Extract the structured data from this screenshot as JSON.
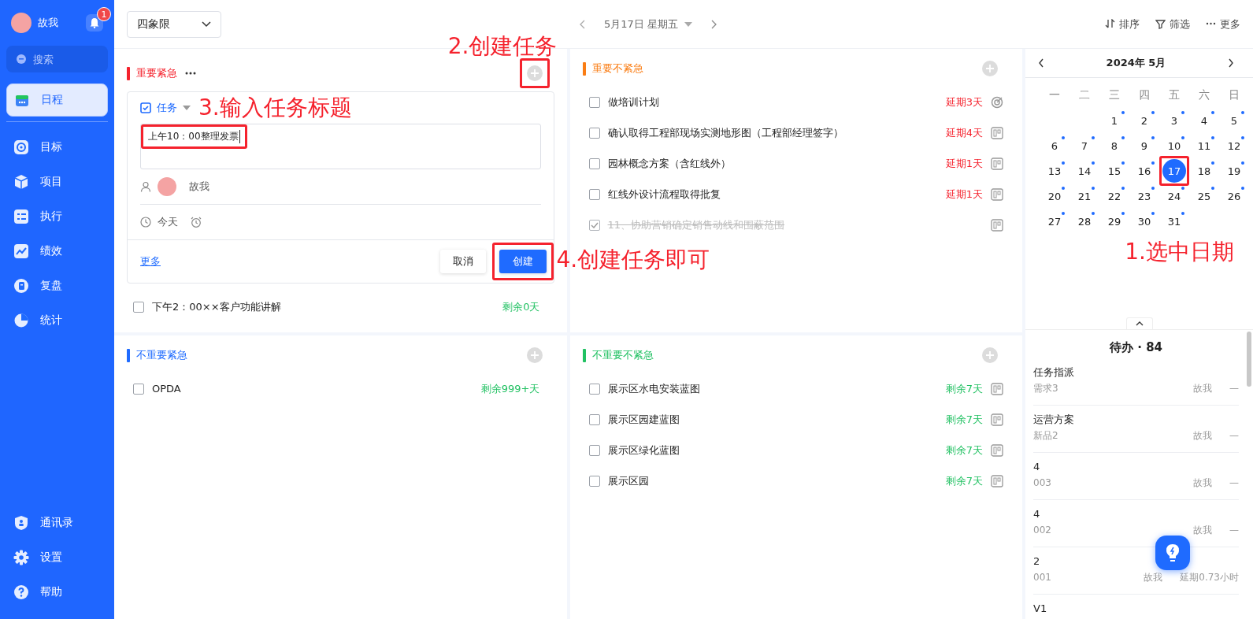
{
  "sidebar": {
    "user": {
      "name": "故我",
      "notification_count": "1"
    },
    "search": {
      "placeholder": "搜索"
    },
    "nav": [
      {
        "label": "日程",
        "kind": "calendar",
        "selected": true
      },
      {
        "label": "目标",
        "kind": "target",
        "selected": false
      },
      {
        "label": "项目",
        "kind": "cube",
        "selected": false
      },
      {
        "label": "执行",
        "kind": "list",
        "selected": false
      },
      {
        "label": "绩效",
        "kind": "chart",
        "selected": false
      },
      {
        "label": "复盘",
        "kind": "review",
        "selected": false
      },
      {
        "label": "统计",
        "kind": "pie",
        "selected": false
      }
    ],
    "bottom_nav": [
      {
        "label": "通讯录",
        "kind": "shield"
      },
      {
        "label": "设置",
        "kind": "gear"
      },
      {
        "label": "帮助",
        "kind": "help"
      }
    ]
  },
  "toolbar": {
    "view": "四象限",
    "date": "5月17日 星期五",
    "actions": [
      {
        "label": "排序",
        "kind": "sort"
      },
      {
        "label": "筛选",
        "kind": "filter"
      },
      {
        "label": "更多",
        "kind": "more"
      }
    ]
  },
  "quadrants": [
    {
      "title": "重要紧急",
      "color": "#f5222d",
      "has_menu": true,
      "add_highlighted": true,
      "add_note": "2.创建任务",
      "form": {
        "type": "任务",
        "type_note": "3.输入任务标题",
        "value": "上午10：00整理发票",
        "value_highlighted": true,
        "assignee": "故我",
        "due": "今天",
        "more": "更多",
        "cancel": "取消",
        "create": "创建",
        "create_highlighted": true,
        "create_note": "4.创建任务即可"
      },
      "tasks": [
        {
          "title": "下午2：00××客户功能讲解",
          "checked": false,
          "status": "剩余0天",
          "overdue": false
        }
      ]
    },
    {
      "title": "重要不紧急",
      "color": "#fa7d14",
      "tasks": [
        {
          "title": "做培训计划",
          "checked": false,
          "status": "延期3天",
          "overdue": true,
          "kind": "goal"
        },
        {
          "title": "确认取得工程部现场实测地形图（工程部经理签字）",
          "checked": false,
          "status": "延期4天",
          "overdue": true,
          "kind": "board"
        },
        {
          "title": "园林概念方案（含红线外）",
          "checked": false,
          "status": "延期1天",
          "overdue": true,
          "kind": "board"
        },
        {
          "title": "红线外设计流程取得批复",
          "checked": false,
          "status": "延期1天",
          "overdue": true,
          "kind": "board"
        },
        {
          "title": "11、协助营销确定销售动线和围蔽范围",
          "checked": true,
          "kind": "board"
        }
      ]
    },
    {
      "title": "不重要紧急",
      "color": "#1f6bff",
      "tasks": [
        {
          "title": "OPDA",
          "checked": false,
          "status": "剩余999+天",
          "overdue": false
        }
      ]
    },
    {
      "title": "不重要不紧急",
      "color": "#21c162",
      "tasks": [
        {
          "title": "展示区水电安装蓝图",
          "checked": false,
          "status": "剩余7天",
          "overdue": false,
          "kind": "board"
        },
        {
          "title": "展示区园建蓝图",
          "checked": false,
          "status": "剩余7天",
          "overdue": false,
          "kind": "board"
        },
        {
          "title": "展示区绿化蓝图",
          "checked": false,
          "status": "剩余7天",
          "overdue": false,
          "kind": "board"
        },
        {
          "title": "展示区园",
          "checked": false,
          "status": "剩余7天",
          "overdue": false,
          "kind": "board"
        }
      ]
    }
  ],
  "calendar": {
    "title": "2024年 5月",
    "weekdays": [
      "一",
      "二",
      "三",
      "四",
      "五",
      "六",
      "日"
    ],
    "note": "1.选中日期",
    "weeks": [
      [
        {
          "day": "1",
          "selected": false,
          "dot": true
        },
        {
          "day": "2",
          "selected": false,
          "dot": true
        },
        {
          "day": "3",
          "selected": false,
          "dot": true
        },
        {
          "day": "4",
          "selected": false,
          "dot": true
        },
        {
          "day": "5",
          "selected": false,
          "dot": true
        }
      ],
      [
        {
          "day": "6",
          "selected": false,
          "dot": true
        },
        {
          "day": "7",
          "selected": false,
          "dot": true
        },
        {
          "day": "8",
          "selected": false,
          "dot": true
        },
        {
          "day": "9",
          "selected": false,
          "dot": true
        },
        {
          "day": "10",
          "selected": false,
          "dot": true
        },
        {
          "day": "11",
          "selected": false,
          "dot": true
        },
        {
          "day": "12",
          "selected": false,
          "dot": true
        }
      ],
      [
        {
          "day": "13",
          "selected": false,
          "dot": true
        },
        {
          "day": "14",
          "selected": false,
          "dot": true
        },
        {
          "day": "15",
          "selected": false,
          "dot": true
        },
        {
          "day": "16",
          "selected": false,
          "dot": true
        },
        {
          "day": "17",
          "selected": true,
          "dot": false,
          "highlighted": true
        },
        {
          "day": "18",
          "selected": false,
          "dot": true
        },
        {
          "day": "19",
          "selected": false,
          "dot": true
        }
      ],
      [
        {
          "day": "20",
          "selected": false,
          "dot": true
        },
        {
          "day": "21",
          "selected": false,
          "dot": true
        },
        {
          "day": "22",
          "selected": false,
          "dot": true
        },
        {
          "day": "23",
          "selected": false,
          "dot": true
        },
        {
          "day": "24",
          "selected": false,
          "dot": true
        },
        {
          "day": "25",
          "selected": false,
          "dot": true
        },
        {
          "day": "26",
          "selected": false,
          "dot": true
        }
      ],
      [
        {
          "day": "27",
          "selected": false,
          "dot": true
        },
        {
          "day": "28",
          "selected": false,
          "dot": true
        },
        {
          "day": "29",
          "selected": false,
          "dot": true
        },
        {
          "day": "30",
          "selected": false,
          "dot": true
        },
        {
          "day": "31",
          "selected": false,
          "dot": true
        }
      ]
    ]
  },
  "todo": {
    "title": "待办 · 84",
    "items": [
      {
        "title": "任务指派",
        "project": "需求3",
        "owner": "故我",
        "due": "—"
      },
      {
        "title": "运营方案",
        "project": "新品2",
        "owner": "故我",
        "due": "—"
      },
      {
        "title": "4",
        "project": "003",
        "owner": "故我",
        "due": "—"
      },
      {
        "title": "4",
        "project": "002",
        "owner": "故我",
        "due": "—"
      },
      {
        "title": "2",
        "project": "001",
        "owner": "故我",
        "due": "延期0.73小时"
      },
      {
        "title": "V1"
      }
    ]
  }
}
